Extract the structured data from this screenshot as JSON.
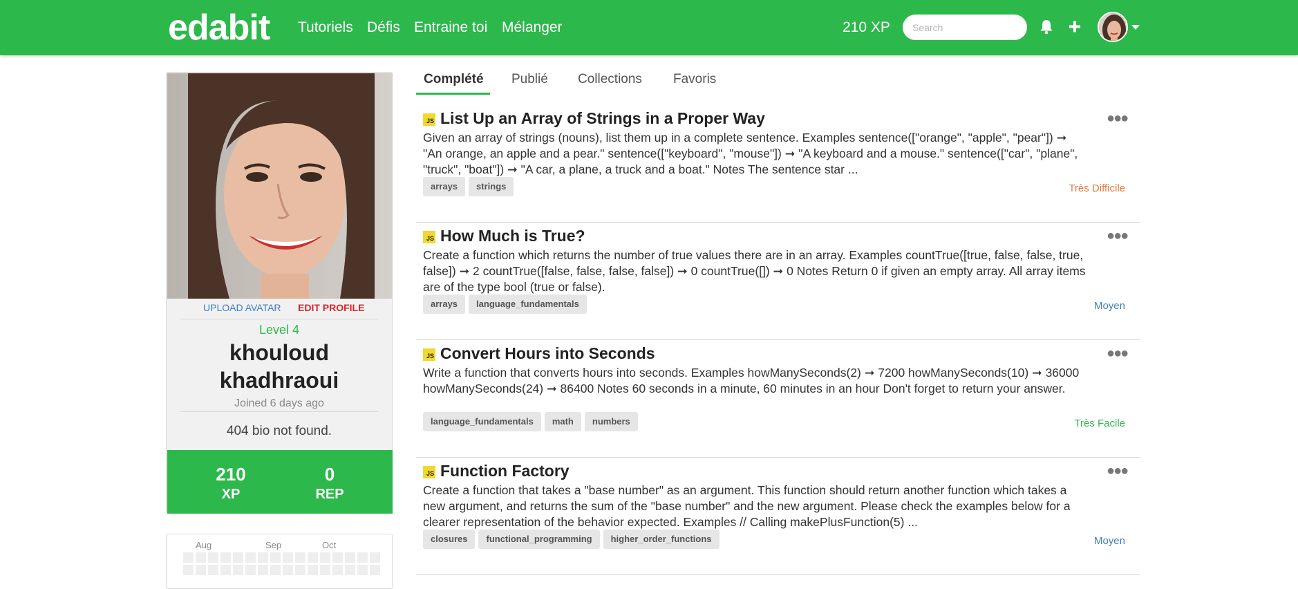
{
  "header": {
    "logo": "edabit",
    "nav": [
      "Tutoriels",
      "Défis",
      "Entraine toi",
      "Mélanger"
    ],
    "xp": "210 XP",
    "search_placeholder": "Search"
  },
  "profile": {
    "upload_avatar": "UPLOAD AVATAR",
    "edit_profile": "EDIT PROFILE",
    "level": "Level 4",
    "name_line1": "khouloud",
    "name_line2": "khadhraoui",
    "joined": "Joined 6 days ago",
    "bio": "404 bio not found.",
    "xp_value": "210",
    "xp_label": "XP",
    "rep_value": "0",
    "rep_label": "REP"
  },
  "calendar": {
    "months": [
      "Aug",
      "Sep",
      "Oct"
    ]
  },
  "tabs": [
    "Complété",
    "Publié",
    "Collections",
    "Favoris"
  ],
  "challenges": [
    {
      "language": "JS",
      "title": "List Up an Array of Strings in a Proper Way",
      "description": "Given an array of strings (nouns), list them up in a complete sentence. Examples sentence([\"orange\", \"apple\", \"pear\"]) ➞ \"An orange, an apple and a pear.\" sentence([\"keyboard\", \"mouse\"]) ➞ \"A keyboard and a mouse.\" sentence([\"car\", \"plane\", \"truck\", \"boat\"]) ➞ \"A car, a plane, a truck and a boat.\" Notes The sentence star ...",
      "tags": [
        "arrays",
        "strings"
      ],
      "difficulty": "Très Difficile",
      "difficulty_color": "#e8793a"
    },
    {
      "language": "JS",
      "title": "How Much is True?",
      "description": "Create a function which returns the number of true values there are in an array. Examples countTrue([true, false, false, true, false]) ➞ 2 countTrue([false, false, false, false]) ➞ 0 countTrue([]) ➞ 0 Notes Return 0 if given an empty array. All array items are of the type bool (true or false).",
      "tags": [
        "arrays",
        "language_fundamentals"
      ],
      "difficulty": "Moyen",
      "difficulty_color": "#3c7fc0"
    },
    {
      "language": "JS",
      "title": "Convert Hours into Seconds",
      "description": "Write a function that converts hours into seconds. Examples howManySeconds(2) ➞ 7200 howManySeconds(10) ➞ 36000 howManySeconds(24) ➞ 86400 Notes 60 seconds in a minute, 60 minutes in an hour Don't forget to return your answer.",
      "tags": [
        "language_fundamentals",
        "math",
        "numbers"
      ],
      "difficulty": "Très Facile",
      "difficulty_color": "#2db84c"
    },
    {
      "language": "JS",
      "title": "Function Factory",
      "description": "Create a function that takes a \"base number\" as an argument. This function should return another function which takes a new argument, and returns the sum of the \"base number\" and the new argument. Please check the examples below for a clearer representation of the behavior expected. Examples // Calling makePlusFunction(5) ...",
      "tags": [
        "closures",
        "functional_programming",
        "higher_order_functions"
      ],
      "difficulty": "Moyen",
      "difficulty_color": "#3c7fc0"
    }
  ],
  "colors": {
    "brand_green": "#2db84c",
    "link_blue": "#3c7fc0",
    "edit_red": "#d9252b",
    "js_yellow": "#f2d82e"
  },
  "icons": [
    "bell-icon",
    "plus-icon",
    "user-avatar",
    "chevron-down-icon",
    "more-options-icon",
    "javascript-icon"
  ]
}
